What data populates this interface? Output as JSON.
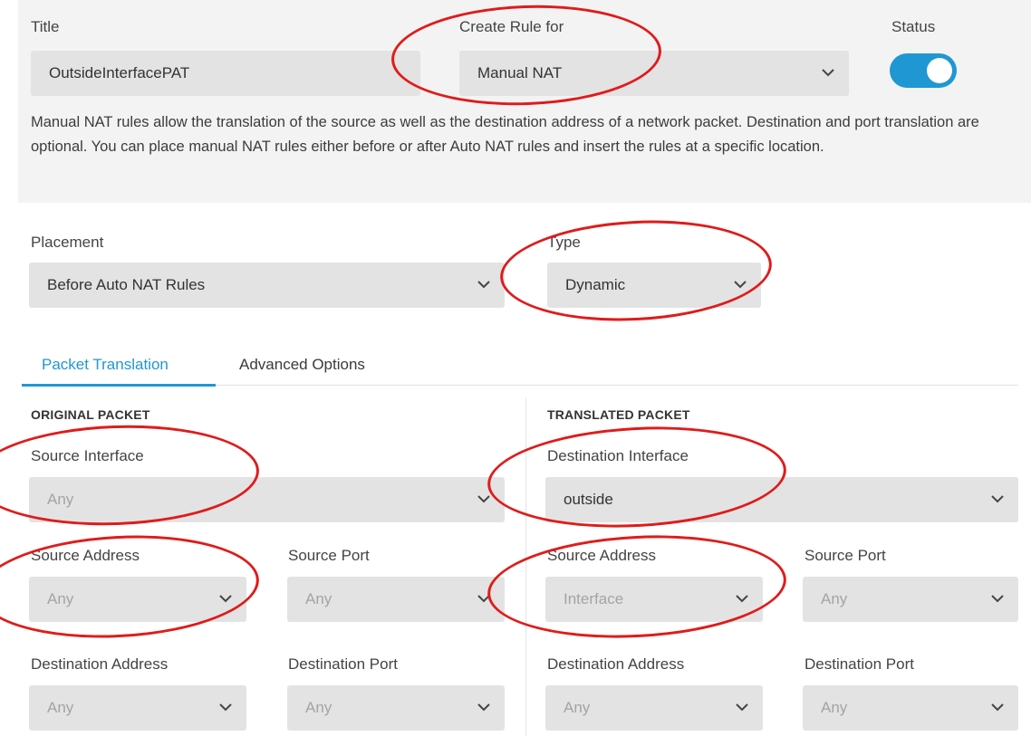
{
  "header": {
    "title_label": "Title",
    "title_value": "OutsideInterfacePAT",
    "create_rule_label": "Create Rule for",
    "create_rule_value": "Manual NAT",
    "status_label": "Status",
    "status_on": true,
    "description": "Manual NAT rules allow the translation of the source as well as the destination address of a network packet. Destination and port translation are optional. You can place manual NAT rules either before or after Auto NAT rules and insert the rules at a specific location."
  },
  "placement": {
    "label": "Placement",
    "value": "Before Auto NAT Rules"
  },
  "type": {
    "label": "Type",
    "value": "Dynamic"
  },
  "tabs": [
    {
      "label": "Packet Translation",
      "active": true
    },
    {
      "label": "Advanced Options",
      "active": false
    }
  ],
  "original_packet": {
    "heading": "ORIGINAL PACKET",
    "source_interface": {
      "label": "Source Interface",
      "value": "Any"
    },
    "source_address": {
      "label": "Source Address",
      "value": "Any"
    },
    "source_port": {
      "label": "Source Port",
      "value": "Any"
    },
    "destination_address": {
      "label": "Destination Address",
      "value": "Any"
    },
    "destination_port": {
      "label": "Destination Port",
      "value": "Any"
    }
  },
  "translated_packet": {
    "heading": "TRANSLATED PACKET",
    "destination_interface": {
      "label": "Destination Interface",
      "value": "outside"
    },
    "source_address": {
      "label": "Source Address",
      "value": "Interface"
    },
    "source_port": {
      "label": "Source Port",
      "value": "Any"
    },
    "destination_address": {
      "label": "Destination Address",
      "value": "Any"
    },
    "destination_port": {
      "label": "Destination Port",
      "value": "Any"
    }
  },
  "colors": {
    "accent": "#1f97d3",
    "highlight": "#e01b1b",
    "panel": "#f3f3f3",
    "field": "#e3e3e3"
  },
  "icons": {
    "dropdown": "chevron-down-icon"
  }
}
